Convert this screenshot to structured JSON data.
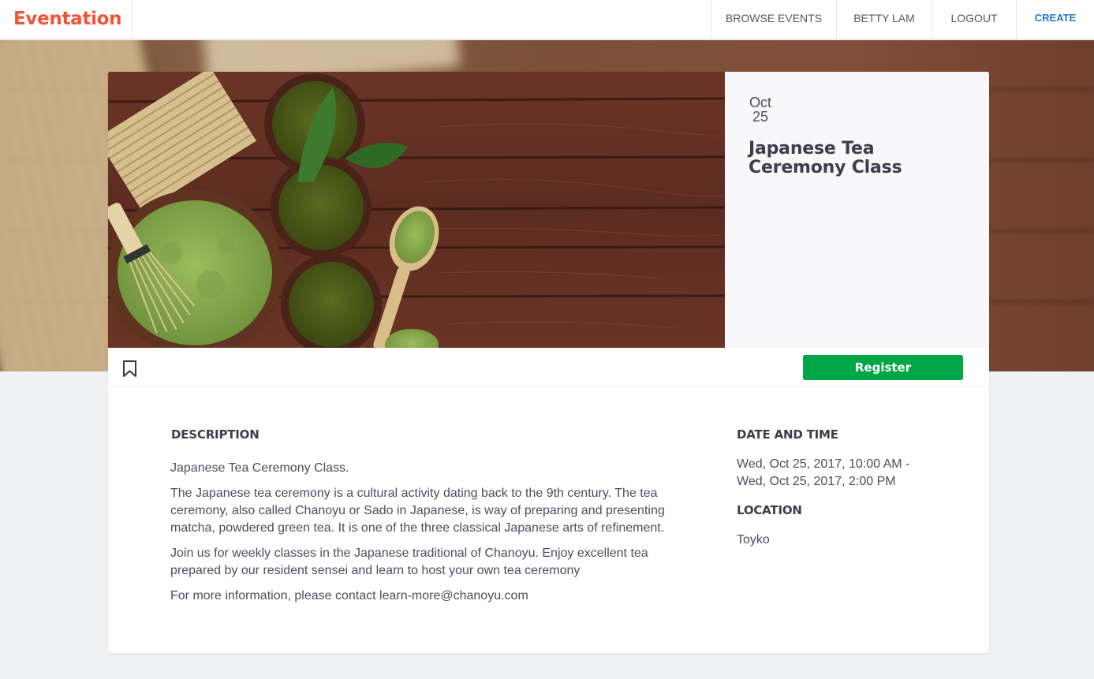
{
  "navbar": {
    "brand": "Eventation",
    "links": {
      "browse": "BROWSE EVENTS",
      "user": "BETTY LAM",
      "logout": "LOGOUT",
      "create": "CREATE"
    }
  },
  "event": {
    "month": "Oct",
    "day": "25",
    "title": "Japanese Tea Ceremony Class",
    "register_label": "Register",
    "description_heading": "DESCRIPTION",
    "description": [
      "Japanese Tea Ceremony Class.",
      "The Japanese tea ceremony is a cultural activity dating back to the 9th century. The tea ceremony, also called Chanoyu or Sado in Japanese, is way of preparing and presenting matcha, powdered green tea. It is one of the three classical Japanese arts of refinement.",
      "Join us for weekly classes in the Japanese traditional of Chanoyu. Enjoy excellent tea prepared by our resident sensei and learn to host your own tea ceremony",
      "For more information, please contact learn-more@chanoyu.com"
    ],
    "datetime_heading": "DATE AND TIME",
    "datetime_start": "Wed, Oct 25, 2017, 10:00 AM -",
    "datetime_end": "Wed, Oct 25, 2017, 2:00 PM",
    "location_heading": "LOCATION",
    "location": "Toyko"
  },
  "colors": {
    "brand": "#f05537",
    "create_link": "#1f79c8",
    "register": "#00a746",
    "page_bg": "#eff1f3"
  },
  "icons": {
    "bookmark": "bookmark-icon"
  }
}
